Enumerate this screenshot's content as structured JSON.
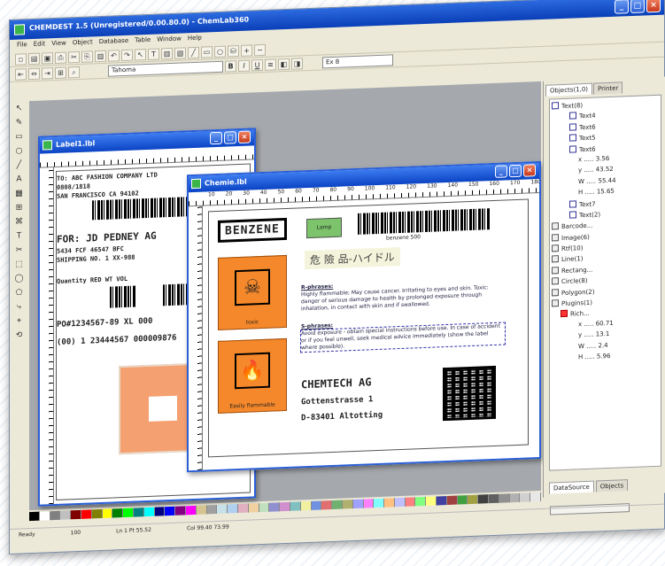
{
  "main_window": {
    "title": "CHEMDEST 1.5 (Unregistered/0.00.80.0) - ChemLab360",
    "menu": [
      "File",
      "Edit",
      "View",
      "Object",
      "Database",
      "Table",
      "Window",
      "Help"
    ],
    "font_name": "Tahoma",
    "font_size": "Ex 8"
  },
  "left_tools": [
    "↖",
    "✎",
    "▭",
    "○",
    "╱",
    "A",
    "▦",
    "⊞",
    "⌘",
    "T",
    "✂",
    "⬚",
    "◯",
    "⬠",
    "⤷",
    "⌖",
    "⟲"
  ],
  "label_doc": {
    "title": "Label1.lbl",
    "lines": [
      "TO: ABC FASHION COMPANY LTD",
      "0808/1818",
      "SAN FRANCISCO CA 94102",
      "FOR: JD PEDNEY AG",
      "5434 FCF 46547 BFC",
      "SHIPPING NO. 1 XX-988",
      "Quantity  RED  WT  VOL",
      "PO#1234567-89  XL 000",
      "(00) 1 23444567 000009876"
    ]
  },
  "chem_doc": {
    "title": "Chemie.lbl",
    "ruler": [
      "10",
      "20",
      "30",
      "40",
      "50",
      "60",
      "70",
      "80",
      "90",
      "100",
      "110",
      "120",
      "130",
      "140",
      "150",
      "160",
      "170",
      "180",
      "190",
      "200",
      "210",
      "220",
      "230",
      "240",
      "250",
      "260",
      "270",
      "280"
    ],
    "product": "BENZENE",
    "green_label": "Lamp",
    "barcode_caption": "benzene 500",
    "cjk_heading": "危 險 品-ハイドル",
    "hazard1_caption": "toxic",
    "hazard2_caption": "Easily flammable",
    "r_phrases_title": "R-phrases:",
    "r_phrases": "Highly flammable; May cause cancer. Irritating to eyes and skin. Toxic: danger of serious damage to health by prolonged exposure through inhalation, in contact with skin and if swallowed.",
    "s_phrases_title": "S-phrases:",
    "s_phrases": "Avoid exposure - obtain special instructions before use. In case of accident or if you feel unwell, seek medical advice immediately (show the label where possible).",
    "company": "CHEMTECH AG",
    "street": "Gottenstrasse 1",
    "city": "D-83401 Altotting"
  },
  "right_panel": {
    "tab_active": "Objects(1,0)",
    "tab_other": "Printer",
    "tree": [
      {
        "label": "Text(8)",
        "icon": "t",
        "indent": 0
      },
      {
        "label": "Text4",
        "icon": "t",
        "indent": 2
      },
      {
        "label": "Text6",
        "icon": "t",
        "indent": 2
      },
      {
        "label": "Text5",
        "icon": "t",
        "indent": 2
      },
      {
        "label": "Text6",
        "icon": "t",
        "indent": 2
      },
      {
        "label": "x ..... 3.56",
        "icon": "",
        "indent": 3
      },
      {
        "label": "y ..... 43.52",
        "icon": "",
        "indent": 3
      },
      {
        "label": "W ..... 55.44",
        "icon": "",
        "indent": 3
      },
      {
        "label": "H ..... 15.65",
        "icon": "",
        "indent": 3
      },
      {
        "label": "Text7",
        "icon": "t",
        "indent": 2
      },
      {
        "label": "Text(2)",
        "icon": "t",
        "indent": 2
      },
      {
        "label": "Barcode...",
        "icon": "f",
        "indent": 0
      },
      {
        "label": "Image(6)",
        "icon": "f",
        "indent": 0
      },
      {
        "label": "Rtf(10)",
        "icon": "f",
        "indent": 0
      },
      {
        "label": "Line(1)",
        "icon": "f",
        "indent": 0
      },
      {
        "label": "Rectang...",
        "icon": "f",
        "indent": 0
      },
      {
        "label": "Circle(8)",
        "icon": "f",
        "indent": 0
      },
      {
        "label": "Polygon(2)",
        "icon": "f",
        "indent": 0
      },
      {
        "label": "Plugins(1)",
        "icon": "f",
        "indent": 0
      },
      {
        "label": "Rich...",
        "icon": "r",
        "indent": 1
      },
      {
        "label": "x ..... 60.71",
        "icon": "",
        "indent": 3
      },
      {
        "label": "y ..... 13.1",
        "icon": "",
        "indent": 3
      },
      {
        "label": "W ..... 2.4",
        "icon": "",
        "indent": 3
      },
      {
        "label": "H ..... 5.96",
        "icon": "",
        "indent": 3
      }
    ],
    "bottom_tab1": "DataSource",
    "bottom_tab2": "Objects"
  },
  "status": {
    "left": "Ready",
    "zoom": "100",
    "pos": "Ln 1 Pt 55.52",
    "size": "Col 99.40 73.99"
  },
  "palette": [
    "#000000",
    "#ffffff",
    "#808080",
    "#c0c0c0",
    "#800000",
    "#ff0000",
    "#808000",
    "#ffff00",
    "#008000",
    "#00ff00",
    "#008080",
    "#00ffff",
    "#000080",
    "#0000ff",
    "#800080",
    "#ff00ff",
    "#d4c490",
    "#a0a0a0",
    "#c8e0e8",
    "#b0d0f0",
    "#e0b0c0",
    "#f0d0a0",
    "#c0e0c0",
    "#9090d0",
    "#d090d0",
    "#80c0c0",
    "#f0f0a0",
    "#7090e0",
    "#e07070",
    "#70b070",
    "#b0b070",
    "#a0a0ff",
    "#ff80ff",
    "#80ffff",
    "#ffc080",
    "#c0c0ff",
    "#ff8080",
    "#80ff80",
    "#ffff80",
    "#4040a0",
    "#a04040",
    "#40a040",
    "#a0a040",
    "#404040",
    "#606060",
    "#909090",
    "#b0b0b0",
    "#d0d0d0",
    "#e8e8e8"
  ]
}
